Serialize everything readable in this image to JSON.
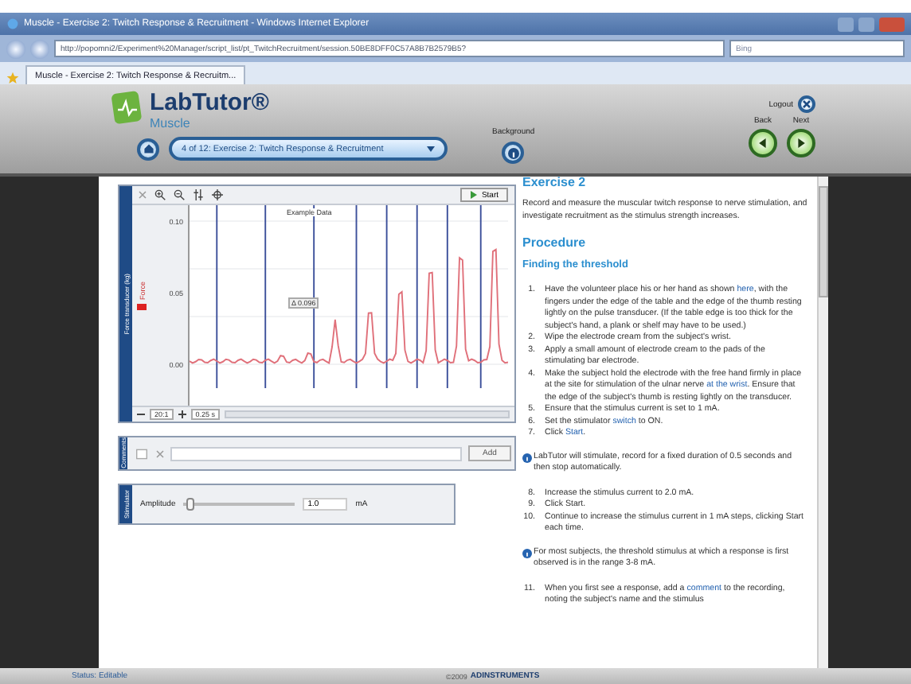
{
  "browser": {
    "title": "Muscle - Exercise 2: Twitch Response & Recruitment - Windows Internet Explorer",
    "address": "http://popomni2/Experiment%20Manager/script_list/pt_TwitchRecruitment/session.50BE8DFF0C57A8B7B2579B5?",
    "search_placeholder": "Bing",
    "tab": "Muscle - Exercise 2: Twitch Response & Recruitm..."
  },
  "app": {
    "logo": "LabTutor®",
    "module": "Muscle",
    "page_select": "4 of 12: Exercise 2: Twitch Response & Recruitment",
    "background_label": "Background",
    "logout_label": "Logout",
    "back_label": "Back",
    "next_label": "Next"
  },
  "chart": {
    "channel_title": "Force transducer (kg)",
    "channel_name": "Force",
    "example_label": "Example Data",
    "marker_reading": "Δ 0.096",
    "y_ticks": [
      "0.10",
      "0.05",
      "0.00"
    ],
    "zoom": "20:1",
    "time_scale": "0.25 s",
    "start": "Start"
  },
  "comments": {
    "label": "Comments",
    "add": "Add"
  },
  "stimulator": {
    "label": "Stimulator",
    "amplitude_label": "Amplitude",
    "level": 0.05,
    "value": "1.0",
    "unit": "mA"
  },
  "instructions": {
    "title": "Exercise 2",
    "intro": "Record and measure the muscular twitch response to nerve stimulation, and investigate recruitment as the stimulus strength increases.",
    "heading": "Procedure",
    "subheading": "Finding the threshold",
    "blocks": [
      {
        "kind": "step",
        "number": "1.",
        "parts": [
          {
            "text": "Have the volunteer place his or her hand as shown ",
            "link": false
          },
          {
            "text": "here",
            "link": true
          },
          {
            "text": ", with the fingers under the edge of the table and the edge of the thumb resting lightly on the pulse transducer. (If the table edge is too thick for the subject's hand, a plank or shelf may have to be used.)",
            "link": false
          }
        ]
      },
      {
        "kind": "step",
        "number": "2.",
        "parts": [
          {
            "text": "Wipe the electrode cream from the subject's wrist.",
            "link": false
          }
        ]
      },
      {
        "kind": "step",
        "number": "3.",
        "parts": [
          {
            "text": "Apply a small amount of electrode cream to the pads of the stimulating bar electrode.",
            "link": false
          }
        ]
      },
      {
        "kind": "step",
        "number": "4.",
        "parts": [
          {
            "text": "Make the subject hold the electrode with the free hand firmly in place at the site for stimulation of the ulnar nerve ",
            "link": false
          },
          {
            "text": "at the wrist",
            "link": true
          },
          {
            "text": ". Ensure that the edge of the subject's thumb is resting lightly on the transducer.",
            "link": false
          }
        ]
      },
      {
        "kind": "step",
        "number": "5.",
        "parts": [
          {
            "text": "Ensure that the stimulus current is set to 1 mA.",
            "link": false
          }
        ]
      },
      {
        "kind": "step",
        "number": "6.",
        "parts": [
          {
            "text": "Set the stimulator ",
            "link": false
          },
          {
            "text": "switch",
            "link": true
          },
          {
            "text": " to ON.",
            "link": false
          }
        ]
      },
      {
        "kind": "step",
        "number": "7.",
        "parts": [
          {
            "text": "Click ",
            "link": false
          },
          {
            "text": "Start",
            "link": true
          },
          {
            "text": ".",
            "link": false
          }
        ]
      },
      {
        "kind": "note",
        "parts": [
          {
            "text": "LabTutor will stimulate, record for a fixed duration of 0.5 seconds and then stop automatically.",
            "link": false
          }
        ]
      },
      {
        "kind": "step",
        "number": "8.",
        "parts": [
          {
            "text": "Increase the stimulus current to 2.0 mA.",
            "link": false
          }
        ]
      },
      {
        "kind": "step",
        "number": "9.",
        "parts": [
          {
            "text": "Click Start.",
            "link": false
          }
        ]
      },
      {
        "kind": "step",
        "number": "10.",
        "parts": [
          {
            "text": "Continue to increase the stimulus current in 1 mA steps, clicking Start each time.",
            "link": false
          }
        ]
      },
      {
        "kind": "note",
        "parts": [
          {
            "text": "For most subjects, the threshold stimulus at which a response is first observed is in the range 3-8 mA.",
            "link": false
          }
        ]
      },
      {
        "kind": "step",
        "number": "11.",
        "parts": [
          {
            "text": "When you first see a response, add a ",
            "link": false
          },
          {
            "text": "comment",
            "link": true
          },
          {
            "text": " to the recording, noting the subject's name and the stimulus",
            "link": false
          }
        ]
      }
    ]
  },
  "status_bar": {
    "status": "Status: Editable",
    "copyright": "©2009",
    "brand": "ADINSTRUMENTS"
  }
}
